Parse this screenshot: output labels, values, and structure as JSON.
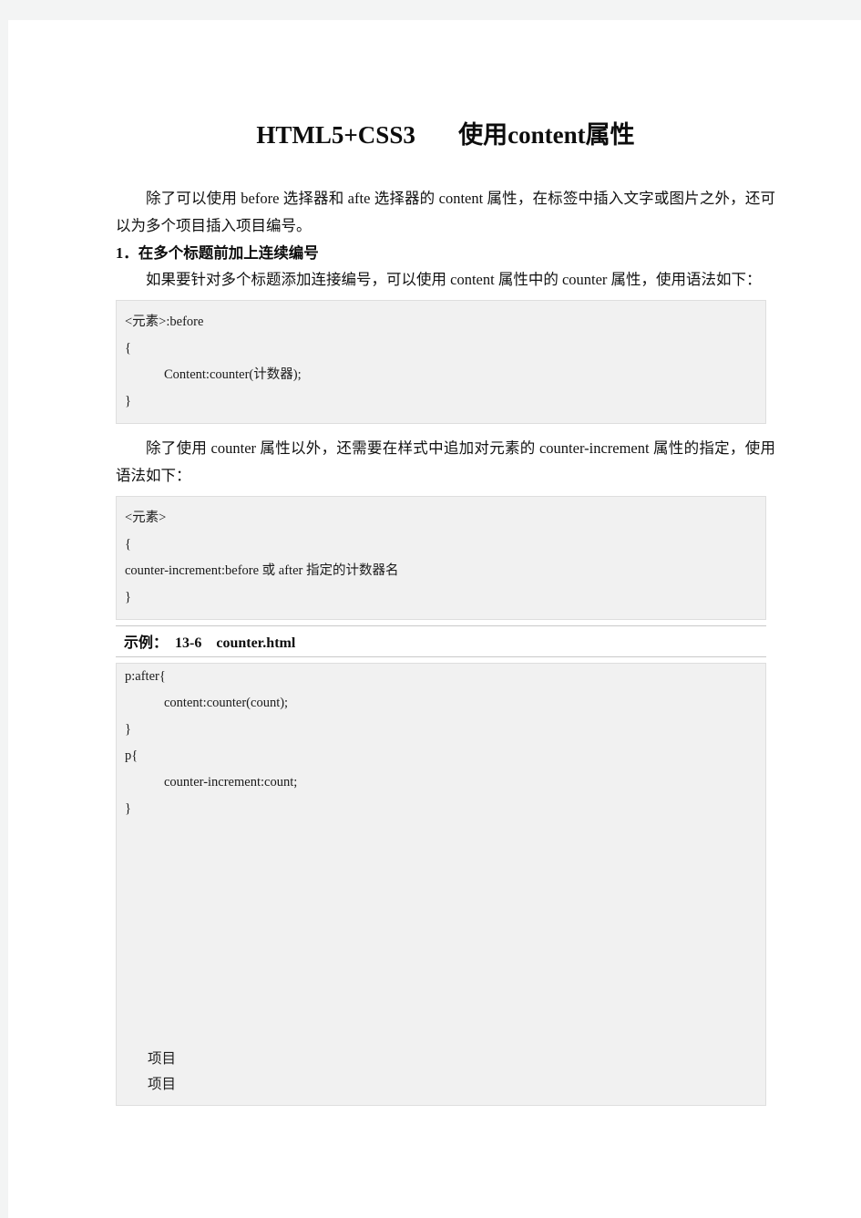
{
  "document": {
    "title": "HTML5+CSS3       使用content属性",
    "paragraphs": {
      "intro": "除了可以使用 before 选择器和 afte 选择器的 content 属性，在标签中插入文字或图片之外，还可以为多个项目插入项目编号。",
      "section_heading": "1．在多个标题前加上连续编号",
      "counter_intro": "如果要针对多个标题添加连接编号，可以使用 content 属性中的 counter 属性，使用语法如下：",
      "increment_intro": "除了使用 counter 属性以外，还需要在样式中追加对元素的 counter-increment 属性的指定，使用语法如下："
    },
    "code_block_1": [
      "<元素>:before",
      "{",
      "Content:counter(计数器);",
      "}"
    ],
    "code_block_2": [
      "<元素>",
      "{",
      "counter-increment:before 或 after 指定的计数器名",
      "}"
    ],
    "example": {
      "label": "示例：",
      "number": "13-6",
      "filename": "counter.html"
    },
    "listing": {
      "lines": [
        "",
        "",
        "",
        "",
        "",
        "",
        "p:after{",
        "content:counter(count);",
        "}",
        "p{",
        "counter-increment:count;",
        "}"
      ],
      "rendered_output": [
        "项目",
        "项目"
      ]
    }
  },
  "colors": {
    "page_background": "#ffffff",
    "canvas_background": "#f3f4f4",
    "code_background": "#f1f1f1",
    "code_border": "#dedede",
    "rule": "#c9c9c9",
    "text": "#121212"
  }
}
